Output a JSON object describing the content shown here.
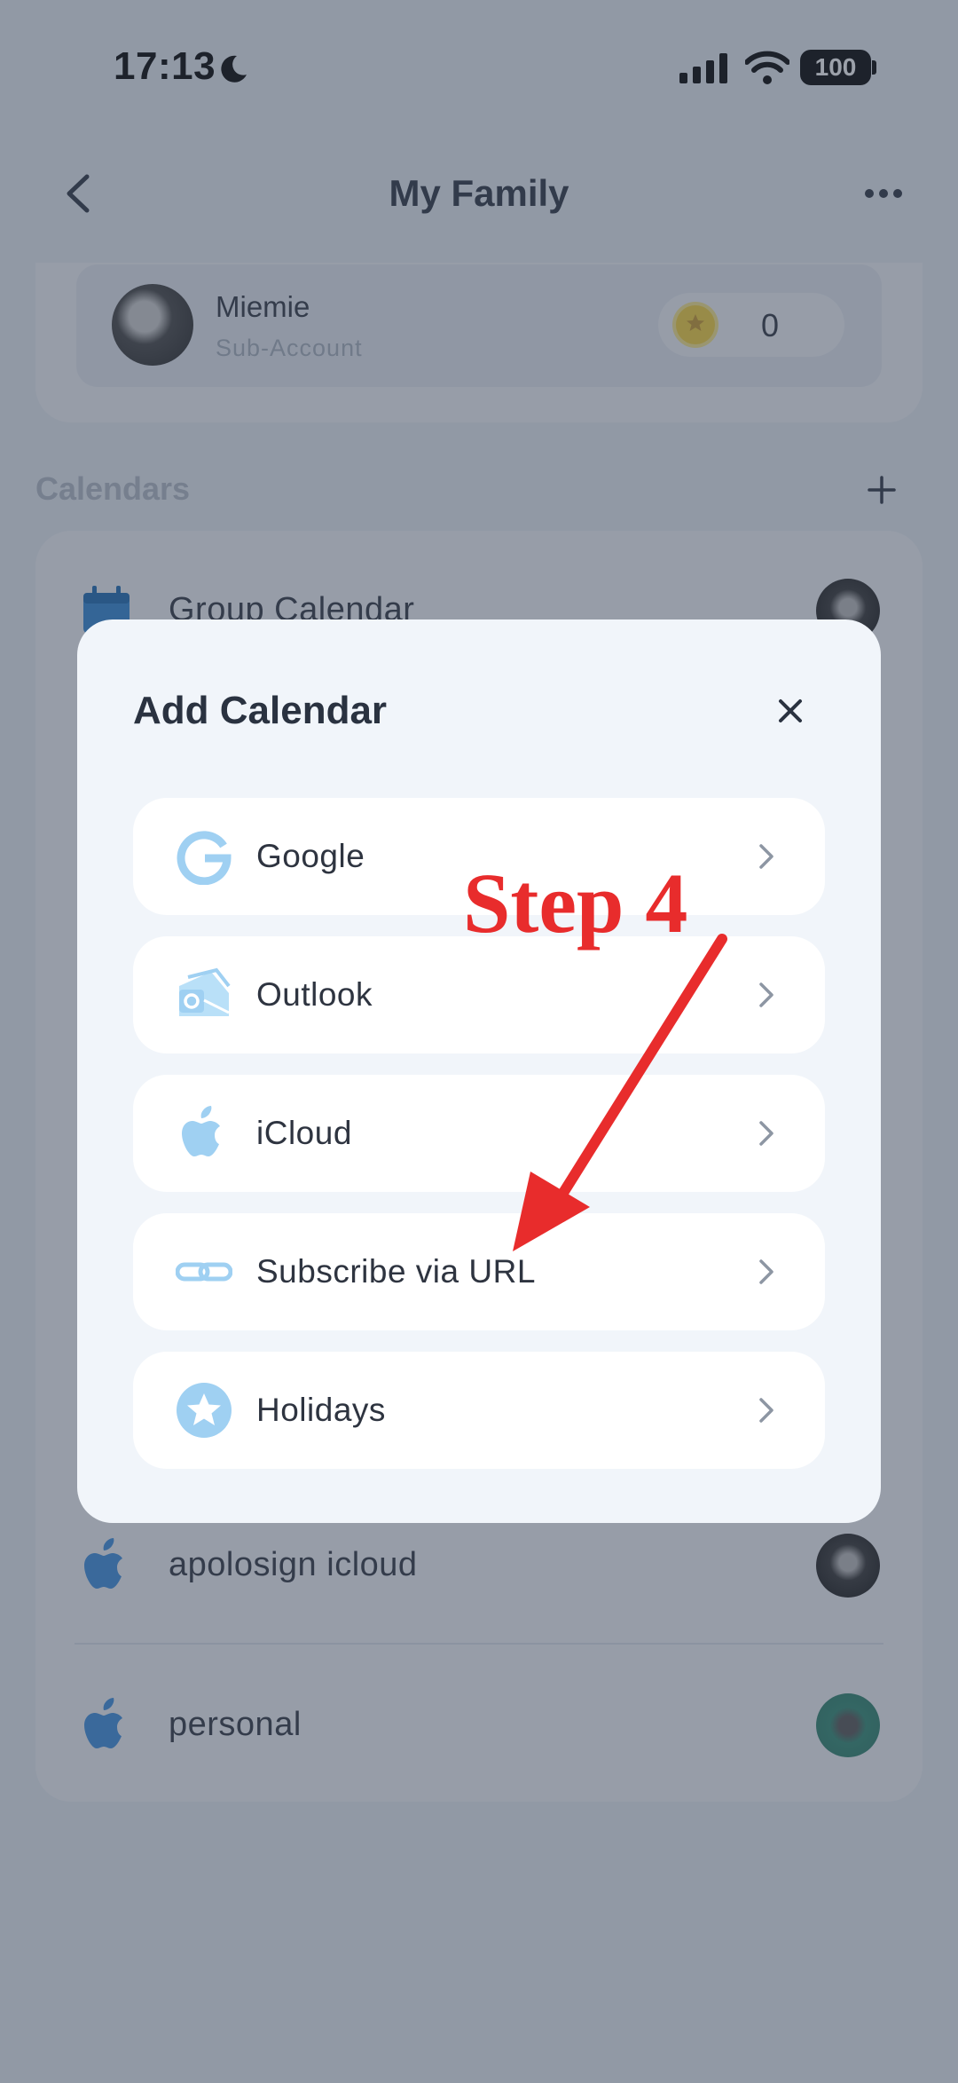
{
  "status_bar": {
    "time": "17:13",
    "battery": "100"
  },
  "header": {
    "title": "My Family"
  },
  "member": {
    "name": "Miemie",
    "role": "Sub-Account",
    "points": "0"
  },
  "calendars": {
    "heading": "Calendars",
    "items": [
      {
        "label": "Group Calendar",
        "icon": "calendar-icon"
      },
      {
        "label": "apolosign icloud",
        "icon": "apple-icon"
      },
      {
        "label": "personal",
        "icon": "apple-icon"
      }
    ]
  },
  "modal": {
    "title": "Add Calendar",
    "options": [
      {
        "label": "Google",
        "icon": "google-icon"
      },
      {
        "label": "Outlook",
        "icon": "outlook-icon"
      },
      {
        "label": "iCloud",
        "icon": "apple-icon"
      },
      {
        "label": "Subscribe via URL",
        "icon": "link-icon"
      },
      {
        "label": "Holidays",
        "icon": "star-icon"
      }
    ]
  },
  "annotation": {
    "text": "Step 4"
  },
  "colors": {
    "icon_blue": "#9fd0f2",
    "annotation_red": "#e82c2c",
    "coin_yellow": "#f6d33a"
  }
}
